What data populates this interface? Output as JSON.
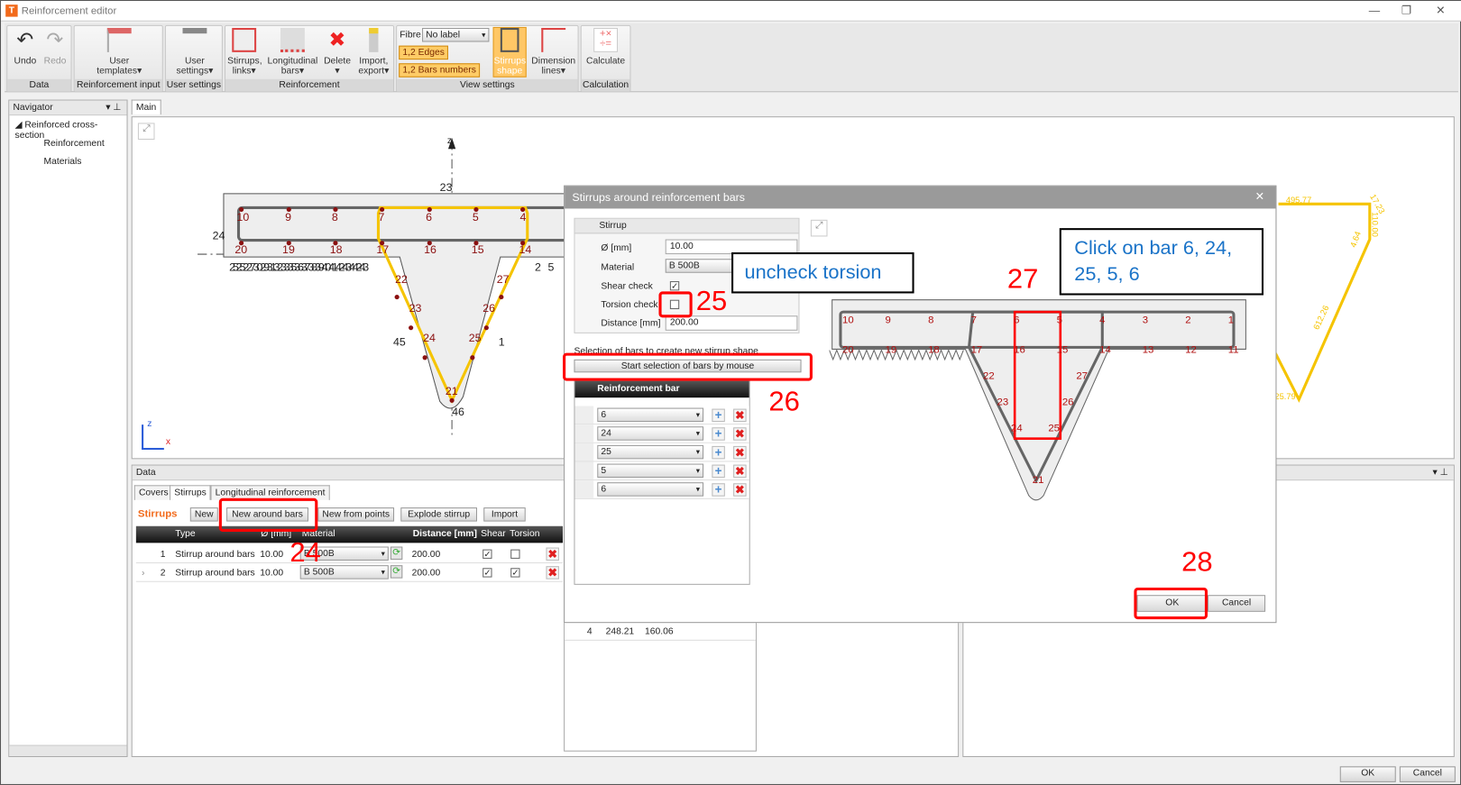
{
  "window": {
    "title": "Reinforcement editor",
    "icon": "T"
  },
  "ribbon": {
    "groups": [
      {
        "label": "Data"
      },
      {
        "label": "Reinforcement input"
      },
      {
        "label": "User settings"
      },
      {
        "label": "Reinforcement"
      },
      {
        "label": "View settings"
      },
      {
        "label": "Calculation"
      }
    ],
    "undo": "Undo",
    "redo": "Redo",
    "user_templates": "User templates▾",
    "user_settings": "User settings▾",
    "stirrups_links": "Stirrups, links▾",
    "longitudinal_bars": "Longitudinal bars▾",
    "delete": "Delete ▾",
    "import_export": "Import, export▾",
    "fibre_label": "Fibre",
    "fibre_value": "No label",
    "edges": "1,2 Edges",
    "bars_numbers": "1,2 Bars numbers",
    "stirrups_shape": "Stirrups shape",
    "dimension_lines": "Dimension lines▾",
    "calculate": "Calculate"
  },
  "navigator": {
    "title": "Navigator",
    "items": [
      "Reinforced cross-section",
      "Reinforcement",
      "Materials"
    ]
  },
  "main": {
    "tab": "Main",
    "axis_z": "z",
    "axis_x": "x",
    "top_bars": [
      "10",
      "9",
      "8",
      "7",
      "6",
      "5",
      "4"
    ],
    "bottom_bars": [
      "20",
      "19",
      "18",
      "17",
      "16",
      "15",
      "14"
    ],
    "web_bars": [
      "22",
      "23",
      "24",
      "21",
      "25",
      "26",
      "27"
    ],
    "edge_labels": [
      "23",
      "24",
      "45",
      "1",
      "46",
      "2",
      "5"
    ],
    "edge_run": "2525227302931323335363738394041424344243",
    "dims": [
      "495.77",
      "17.23",
      "110.00",
      "4.64",
      "612.26",
      "25.79"
    ]
  },
  "data_panel": {
    "title": "Data",
    "tabs": [
      "Covers",
      "Stirrups",
      "Longitudinal reinforcement"
    ],
    "section": "Stirrups",
    "buttons": [
      "New",
      "New around bars",
      "New from points",
      "Explode stirrup",
      "Import"
    ],
    "columns": [
      "Type",
      "Ø [mm]",
      "Material",
      "Distance [mm]",
      "Shear",
      "Torsion"
    ],
    "rows": [
      {
        "n": "1",
        "type": "Stirrup around bars",
        "d": "10.00",
        "material": "B 500B",
        "distance": "200.00",
        "shear": true,
        "torsion": false
      },
      {
        "n": "2",
        "type": "Stirrup around bars",
        "d": "10.00",
        "material": "B 500B",
        "distance": "200.00",
        "shear": true,
        "torsion": true
      }
    ]
  },
  "sub_table": {
    "row": [
      "4",
      "248.21",
      "160.06"
    ]
  },
  "dialog": {
    "title": "Stirrups around reinforcement bars",
    "group": "Stirrup",
    "labels": {
      "d": "Ø [mm]",
      "material": "Material",
      "shear": "Shear check",
      "torsion": "Torsion check",
      "distance": "Distance [mm]"
    },
    "values": {
      "d": "10.00",
      "material": "B 500B",
      "distance": "200.00",
      "shear": true,
      "torsion": false
    },
    "selection_text": "Selection of bars to create new stirrup shape",
    "start_button": "Start selection of bars by mouse",
    "bar_column": "Reinforcement bar",
    "bars": [
      "6",
      "24",
      "25",
      "5",
      "6"
    ],
    "preview_top": [
      "10",
      "9",
      "8",
      "7",
      "6",
      "5",
      "4",
      "3",
      "2",
      "1"
    ],
    "preview_bottom": [
      "20",
      "19",
      "18",
      "17",
      "16",
      "15",
      "14",
      "13",
      "12",
      "11"
    ],
    "preview_web": [
      "22",
      "23",
      "24",
      "21",
      "25",
      "26",
      "27"
    ],
    "ok": "OK",
    "cancel": "Cancel"
  },
  "footer": {
    "ok": "OK",
    "cancel": "Cancel"
  },
  "annotations": {
    "n24": "24",
    "n25": "25",
    "n26": "26",
    "n27": "27",
    "n28": "28",
    "callout_torsion": "uncheck torsion",
    "callout_bars": "Click on bar 6, 24, 25, 5, 6"
  },
  "colors": {
    "accent": "#f26a1b",
    "stirrup": "#f5c400",
    "bar": "#8b1010",
    "annotation": "#ff0000",
    "callout": "#1a73c8"
  }
}
